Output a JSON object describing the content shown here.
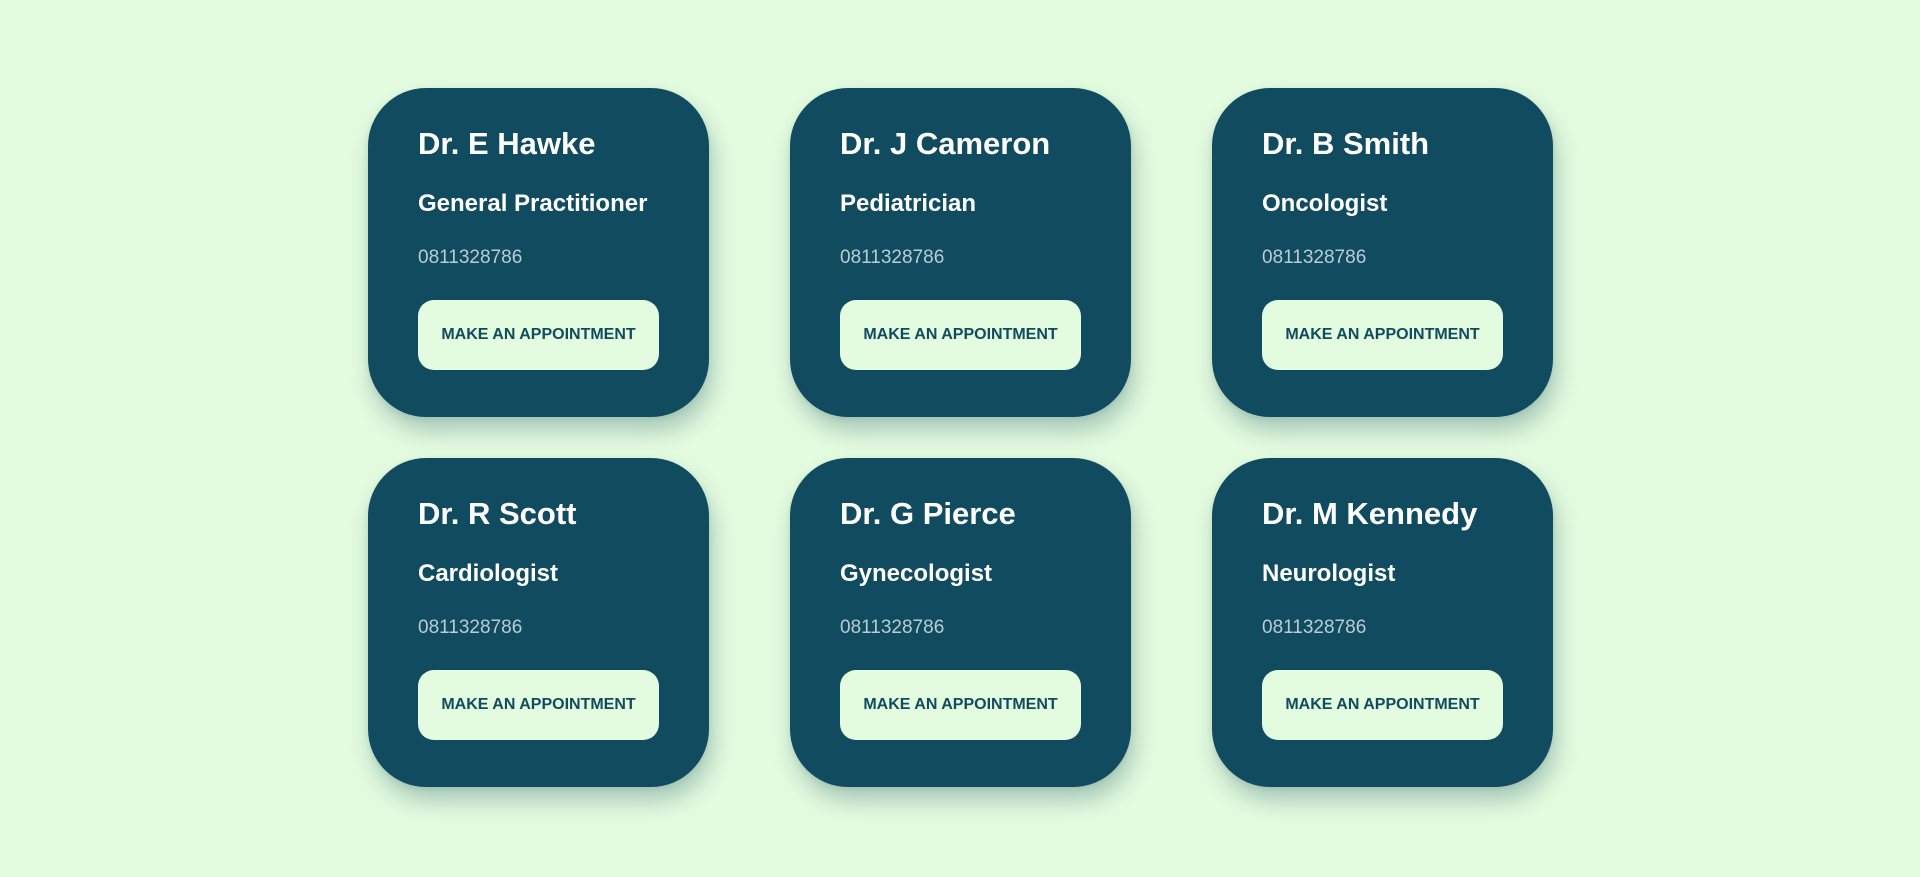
{
  "doctors": [
    {
      "name": "Dr. E Hawke",
      "specialty": "General Practitioner",
      "phone": "0811328786",
      "button_label": "MAKE AN APPOINTMENT"
    },
    {
      "name": "Dr. J Cameron",
      "specialty": "Pediatrician",
      "phone": "0811328786",
      "button_label": "MAKE AN APPOINTMENT"
    },
    {
      "name": "Dr. B Smith",
      "specialty": "Oncologist",
      "phone": "0811328786",
      "button_label": "MAKE AN APPOINTMENT"
    },
    {
      "name": "Dr. R Scott",
      "specialty": "Cardiologist",
      "phone": "0811328786",
      "button_label": "MAKE AN APPOINTMENT"
    },
    {
      "name": "Dr. G Pierce",
      "specialty": "Gynecologist",
      "phone": "0811328786",
      "button_label": "MAKE AN APPOINTMENT"
    },
    {
      "name": "Dr. M Kennedy",
      "specialty": "Neurologist",
      "phone": "0811328786",
      "button_label": "MAKE AN APPOINTMENT"
    }
  ],
  "colors": {
    "background": "#e3fbdf",
    "card": "#114b5f",
    "button_bg": "#e3fbdf",
    "button_text": "#114b5f",
    "phone_text": "#b9cdd3"
  }
}
